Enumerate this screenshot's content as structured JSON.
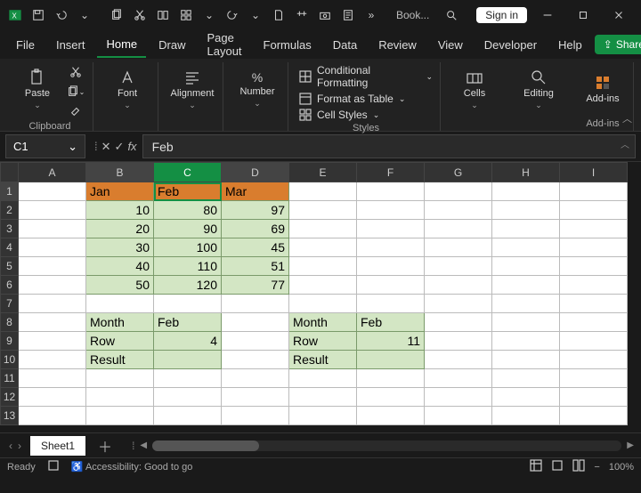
{
  "titlebar": {
    "doc_name": "Book...",
    "signin": "Sign in"
  },
  "tabs": {
    "items": [
      "File",
      "Insert",
      "Home",
      "Draw",
      "Page Layout",
      "Formulas",
      "Data",
      "Review",
      "View",
      "Developer",
      "Help"
    ],
    "active": 2,
    "share": "Share"
  },
  "ribbon": {
    "clipboard": {
      "paste": "Paste",
      "group": "Clipboard"
    },
    "font": {
      "label": "Font"
    },
    "alignment": {
      "label": "Alignment"
    },
    "number": {
      "label": "Number"
    },
    "styles": {
      "cond": "Conditional Formatting",
      "table": "Format as Table",
      "cell": "Cell Styles",
      "group": "Styles"
    },
    "cells": {
      "label": "Cells"
    },
    "editing": {
      "label": "Editing"
    },
    "addins": {
      "label": "Add-ins",
      "group": "Add-ins"
    }
  },
  "namebox": {
    "ref": "C1"
  },
  "formula": {
    "value": "Feb"
  },
  "columns": [
    "A",
    "B",
    "C",
    "D",
    "E",
    "F",
    "G",
    "H",
    "I"
  ],
  "rows": [
    "1",
    "2",
    "3",
    "4",
    "5",
    "6",
    "7",
    "8",
    "9",
    "10",
    "11",
    "12",
    "13"
  ],
  "cells": {
    "B1": "Jan",
    "C1": "Feb",
    "D1": "Mar",
    "B2": "10",
    "C2": "80",
    "D2": "97",
    "B3": "20",
    "C3": "90",
    "D3": "69",
    "B4": "30",
    "C4": "100",
    "D4": "45",
    "B5": "40",
    "C5": "110",
    "D5": "51",
    "B6": "50",
    "C6": "120",
    "D6": "77",
    "B8": "Month",
    "C8": "Feb",
    "B9": "Row",
    "C9": "4",
    "B10": "Result",
    "E8": "Month",
    "F8": "Feb",
    "E9": "Row",
    "F9": "11",
    "E10": "Result"
  },
  "sheets": {
    "active": "Sheet1"
  },
  "status": {
    "ready": "Ready",
    "acc": "Accessibility: Good to go",
    "zoom": "100%"
  }
}
